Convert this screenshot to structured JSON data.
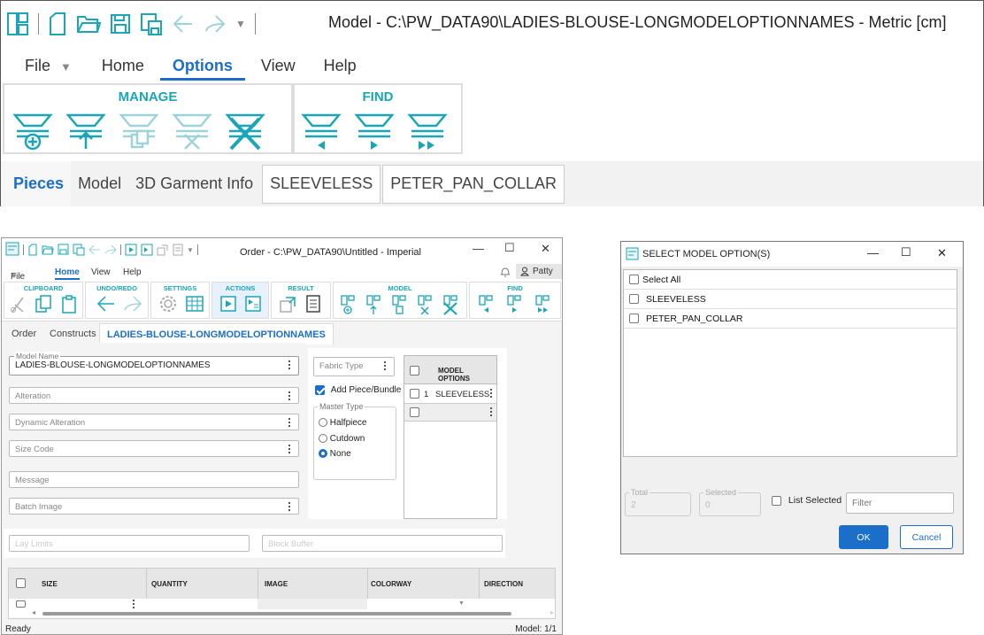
{
  "top": {
    "title": "Model - C:\\PW_DATA90\\LADIES-BLOUSE-LONGMODELOPTIONNAMES - Metric [cm]",
    "menu": [
      "File",
      "Home",
      "Options",
      "View",
      "Help"
    ],
    "groups": {
      "manage": "MANAGE",
      "find": "FIND"
    },
    "tabs": [
      "Pieces",
      "Model",
      "3D Garment Info",
      "SLEEVELESS",
      "PETER_PAN_COLLAR"
    ]
  },
  "order": {
    "title": "Order - C:\\PW_DATA90\\Untitled - Imperial",
    "menu": [
      "File",
      "Home",
      "View",
      "Help"
    ],
    "user": "Patty",
    "ribbon_groups": [
      "CLIPBOARD",
      "UNDO/REDO",
      "SETTINGS",
      "ACTIONS",
      "RESULT",
      "MODEL",
      "FIND"
    ],
    "tabs": [
      "Order",
      "Constructs",
      "LADIES-BLOUSE-LONGMODELOPTIONNAMES"
    ],
    "model_name_label": "Model Name",
    "model_name_value": "LADIES-BLOUSE-LONGMODELOPTIONNAMES",
    "fields": [
      "Alteration",
      "Dynamic Alteration",
      "Size Code",
      "Message",
      "Batch Image"
    ],
    "fabric_type": "Fabric Type",
    "add_piece": "Add Piece/Bundle",
    "master_type_label": "Master Type",
    "master_type_options": [
      "Halfpiece",
      "Cutdown",
      "None"
    ],
    "model_options_header": "MODEL OPTIONS",
    "model_options_rows": [
      {
        "num": "1",
        "value": "SLEEVELESS"
      }
    ],
    "lay_limits": "Lay Limits",
    "block_buffer": "Block Buffer",
    "grid_headers": [
      "SIZE",
      "QUANTITY",
      "IMAGE",
      "COLORWAY",
      "DIRECTION"
    ],
    "status_left": "Ready",
    "status_right": "Model: 1/1"
  },
  "dialog": {
    "title": "SELECT MODEL OPTION(S)",
    "select_all": "Select All",
    "options": [
      "SLEEVELESS",
      "PETER_PAN_COLLAR"
    ],
    "total_label": "Total",
    "total_value": "2",
    "selected_label": "Selected",
    "selected_value": "0",
    "list_selected": "List Selected",
    "filter_placeholder": "Filter",
    "ok": "OK",
    "cancel": "Cancel"
  },
  "colors": {
    "accent": "#1b6fc9",
    "teal": "#1aa6b7"
  }
}
